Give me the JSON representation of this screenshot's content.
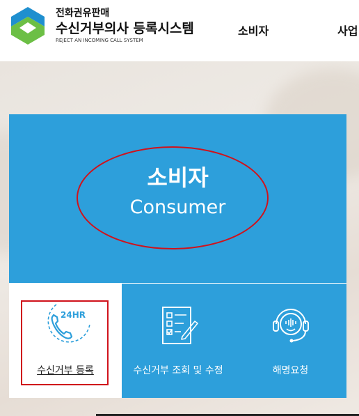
{
  "header": {
    "logo_line1": "전화권유판매",
    "logo_line2": "수신거부의사 등록시스템",
    "logo_line3": "REJECT AN INCOMING CALL SYSTEM",
    "nav": [
      "소비자",
      "사업"
    ]
  },
  "card": {
    "title_ko": "소비자",
    "title_en": "Consumer",
    "menu": [
      {
        "label": "수신거부 등록",
        "icon": "phone-24hr-icon",
        "badge": "24HR"
      },
      {
        "label": "수신거부 조회 및 수정",
        "icon": "checklist-icon"
      },
      {
        "label": "해명요청",
        "icon": "headset-icon"
      }
    ]
  },
  "colors": {
    "accent_blue": "#2d9fdb",
    "annotation_red": "#d0121b",
    "logo_blue": "#1f8fcf",
    "logo_green": "#6cbf45"
  }
}
